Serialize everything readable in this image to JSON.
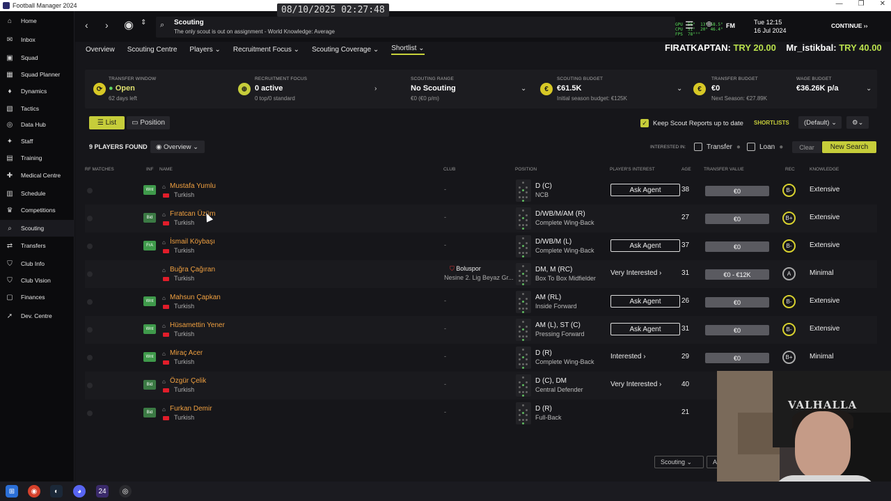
{
  "window": {
    "title": "Football Manager 2024",
    "controls": [
      "—",
      "❐",
      "✕"
    ]
  },
  "sidebar": {
    "items": [
      {
        "label": "Home",
        "icon": "home-icon",
        "glyph": "⌂"
      },
      {
        "label": "Inbox",
        "icon": "inbox-icon",
        "glyph": "✉"
      },
      {
        "label": "Squad",
        "icon": "squad-icon",
        "glyph": "▣"
      },
      {
        "label": "Squad Planner",
        "icon": "squad-planner-icon",
        "glyph": "▦"
      },
      {
        "label": "Dynamics",
        "icon": "dynamics-icon",
        "glyph": "♦"
      },
      {
        "label": "Tactics",
        "icon": "tactics-icon",
        "glyph": "▧"
      },
      {
        "label": "Data Hub",
        "icon": "data-hub-icon",
        "glyph": "◎"
      },
      {
        "label": "Staff",
        "icon": "staff-icon",
        "glyph": "✦"
      },
      {
        "label": "Training",
        "icon": "training-icon",
        "glyph": "▤"
      },
      {
        "label": "Medical Centre",
        "icon": "medical-icon",
        "glyph": "✚"
      },
      {
        "label": "Schedule",
        "icon": "schedule-icon",
        "glyph": "▥"
      },
      {
        "label": "Competitions",
        "icon": "trophy-icon",
        "glyph": "♛"
      },
      {
        "label": "Scouting",
        "icon": "scouting-icon",
        "glyph": "⌕"
      },
      {
        "label": "Transfers",
        "icon": "transfers-icon",
        "glyph": "⇄"
      },
      {
        "label": "Club Info",
        "icon": "club-info-icon",
        "glyph": "⛉"
      },
      {
        "label": "Club Vision",
        "icon": "club-vision-icon",
        "glyph": "⛉"
      },
      {
        "label": "Finances",
        "icon": "finances-icon",
        "glyph": "▢"
      },
      {
        "label": "Dev. Centre",
        "icon": "dev-centre-icon",
        "glyph": "➚"
      }
    ]
  },
  "header": {
    "page_title": "Scouting",
    "subtitle": "The only scout is out on assignment - World Knowledge: Average",
    "day_time": "Tue 12:15",
    "date": "16 Jul 2024",
    "fm_label": "FM",
    "continue_label": "CONTINUE"
  },
  "overlay": {
    "clock": "08/10/2025 02:27:48",
    "ticker_user1": "FIRATKAPTAN:",
    "ticker_amt1": "TRY 20.00",
    "ticker_user2": "Mr_istikbal:",
    "ticker_amt2": "TRY 40.00",
    "stats": "GPU  56°  13° 58.5°\nCPU  51°  20° 46.4°\nFPS  78°°°"
  },
  "subnav": {
    "tabs": [
      "Overview",
      "Scouting Centre",
      "Players ⌄",
      "Recruitment Focus ⌄",
      "Scouting Coverage ⌄",
      "Shortlist ⌄"
    ]
  },
  "info": {
    "transfer_window_label": "TRANSFER WINDOW",
    "transfer_window_value": "Open",
    "transfer_window_note": "62 days left",
    "recruitment_label": "RECRUITMENT FOCUS",
    "recruitment_value": "0 active",
    "recruitment_note": "0 top/0 standard",
    "range_label": "SCOUTING RANGE",
    "range_value": "No Scouting",
    "range_note": "€0 (€0 p/m)",
    "budget_label": "SCOUTING BUDGET",
    "budget_value": "€61.5K",
    "budget_note": "Initial season budget: €125K",
    "transfer_budget_label": "TRANSFER BUDGET",
    "transfer_budget_value": "€0",
    "transfer_budget_note": "Next Season: €27.89K",
    "wage_label": "WAGE BUDGET",
    "wage_value": "€36.26K p/a"
  },
  "toolbar": {
    "list_label": "List",
    "position_label": "Position",
    "keep_label": "Keep Scout Reports up to date",
    "shortlists_label": "SHORTLISTS",
    "default_label": "(Default)"
  },
  "filters": {
    "found_label": "9 PLAYERS FOUND",
    "view_label": "Overview",
    "interested_label": "INTERESTED IN:",
    "transfer_label": "Transfer",
    "loan_label": "Loan",
    "clear_label": "Clear",
    "new_search_label": "New Search"
  },
  "table": {
    "headers": [
      "RF MATCHES",
      "INF",
      "NAME",
      "CLUB",
      "POSITION",
      "PLAYER'S INTEREST",
      "AGE",
      "TRANSFER VALUE",
      "REC",
      "KNOWLEDGE"
    ],
    "rows": [
      {
        "inf": "Wnt",
        "name": "Mustafa Yumlu",
        "nat": "Turkish",
        "club": "-",
        "pos": "D (C)",
        "role": "NCB",
        "interest": "Ask Agent",
        "interest_btn": true,
        "age": "38",
        "value": "€0",
        "rec": "B-",
        "know": "Extensive"
      },
      {
        "inf": "Bid",
        "name": "Fıratcan Üzüm",
        "nat": "Turkish",
        "club": "-",
        "pos": "D/WB/M/AM (R)",
        "role": "Complete Wing-Back",
        "interest": "",
        "interest_btn": false,
        "age": "27",
        "value": "€0",
        "rec": "B+",
        "know": "Extensive"
      },
      {
        "inf": "FrA",
        "name": "İsmail Köybaşı",
        "nat": "Turkish",
        "club": "-",
        "pos": "D/WB/M (L)",
        "role": "Complete Wing-Back",
        "interest": "Ask Agent",
        "interest_btn": true,
        "age": "37",
        "value": "€0",
        "rec": "B-",
        "know": "Extensive"
      },
      {
        "inf": "",
        "name": "Buğra Çağıran",
        "nat": "Turkish",
        "club": "Boluspor",
        "club_sub": "Nesine 2. Lig Beyaz Gr...",
        "pos": "DM, M (RC)",
        "role": "Box To Box Midfielder",
        "interest": "Very Interested ›",
        "interest_btn": false,
        "age": "31",
        "value": "€0 - €12K",
        "rec": "A",
        "know": "Minimal"
      },
      {
        "inf": "Wnt",
        "name": "Mahsun Çapkan",
        "nat": "Turkish",
        "club": "-",
        "pos": "AM (RL)",
        "role": "Inside Forward",
        "interest": "Ask Agent",
        "interest_btn": true,
        "age": "26",
        "value": "€0",
        "rec": "B-",
        "know": "Extensive"
      },
      {
        "inf": "Wnt",
        "name": "Hüsamettin Yener",
        "nat": "Turkish",
        "club": "-",
        "pos": "AM (L), ST (C)",
        "role": "Pressing Forward",
        "interest": "Ask Agent",
        "interest_btn": true,
        "age": "31",
        "value": "€0",
        "rec": "B-",
        "know": "Extensive"
      },
      {
        "inf": "Wnt",
        "name": "Miraç Acer",
        "nat": "Turkish",
        "club": "-",
        "pos": "D (R)",
        "role": "Complete Wing-Back",
        "interest": "Interested ›",
        "interest_btn": false,
        "age": "29",
        "value": "€0",
        "rec": "B+",
        "know": "Minimal"
      },
      {
        "inf": "Bid",
        "name": "Özgür Çelik",
        "nat": "Turkish",
        "club": "-",
        "pos": "D (C), DM",
        "role": "Central Defender",
        "interest": "Very Interested ›",
        "interest_btn": false,
        "age": "40",
        "value": "",
        "rec": "",
        "know": ""
      },
      {
        "inf": "Bid",
        "name": "Furkan Demir",
        "nat": "Turkish",
        "club": "-",
        "pos": "D (R)",
        "role": "Full-Back",
        "interest": "",
        "interest_btn": false,
        "age": "21",
        "value": "",
        "rec": "",
        "know": ""
      }
    ]
  },
  "bottom": {
    "scouting_dd": "Scouting ⌄"
  },
  "webcam": {
    "banner_text": "VALHALLA"
  },
  "colors": {
    "accent": "#c6cd3a",
    "name": "#f0a040",
    "bg": "#16161a"
  }
}
